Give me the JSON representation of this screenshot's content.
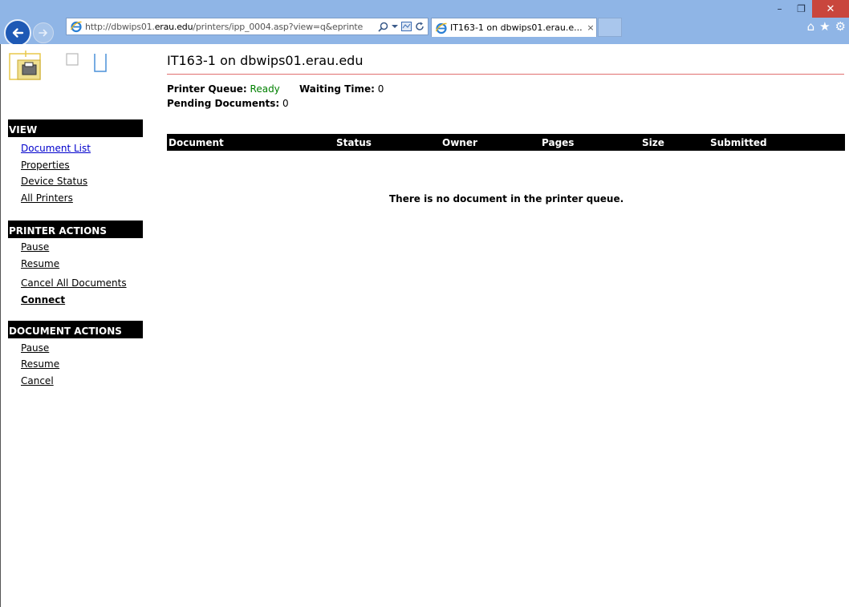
{
  "browser": {
    "address": {
      "prefix": "http://dbwips01.",
      "host": "erau.edu",
      "path": "/printers/ipp_0004.asp?view=q&eprinte"
    },
    "tab_title": "IT163-1 on dbwips01.erau.e...",
    "tab_close": "×",
    "window_controls": {
      "minimize": "–",
      "restore": "❐",
      "close": "✕"
    },
    "icons": [
      "back-arrow-icon",
      "forward-arrow-icon",
      "ie-logo-icon",
      "search-icon",
      "dropdown-icon",
      "compatibility-icon",
      "refresh-icon",
      "home-icon",
      "favorites-star-icon",
      "settings-gear-icon"
    ],
    "accent_color": "#8fb5e6"
  },
  "sidebar": {
    "view": {
      "header": "VIEW",
      "items": [
        "Document List",
        "Properties",
        "Device Status",
        "All Printers"
      ]
    },
    "printer_actions": {
      "header": "PRINTER ACTIONS",
      "items": [
        "Pause",
        "Resume",
        "Cancel All Documents",
        "Connect"
      ]
    },
    "document_actions": {
      "header": "DOCUMENT ACTIONS",
      "items": [
        "Pause",
        "Resume",
        "Cancel"
      ]
    }
  },
  "main": {
    "title": "IT163-1 on dbwips01.erau.edu",
    "queue_label": "Printer Queue:",
    "queue_value": "Ready",
    "waiting_label": "Waiting Time:",
    "waiting_value": "0",
    "pending_label": "Pending Documents:",
    "pending_value": "0",
    "columns": [
      "Document",
      "Status",
      "Owner",
      "Pages",
      "Size",
      "Submitted"
    ],
    "empty_message": "There is no document in the printer queue.",
    "status_color": "#008000"
  }
}
